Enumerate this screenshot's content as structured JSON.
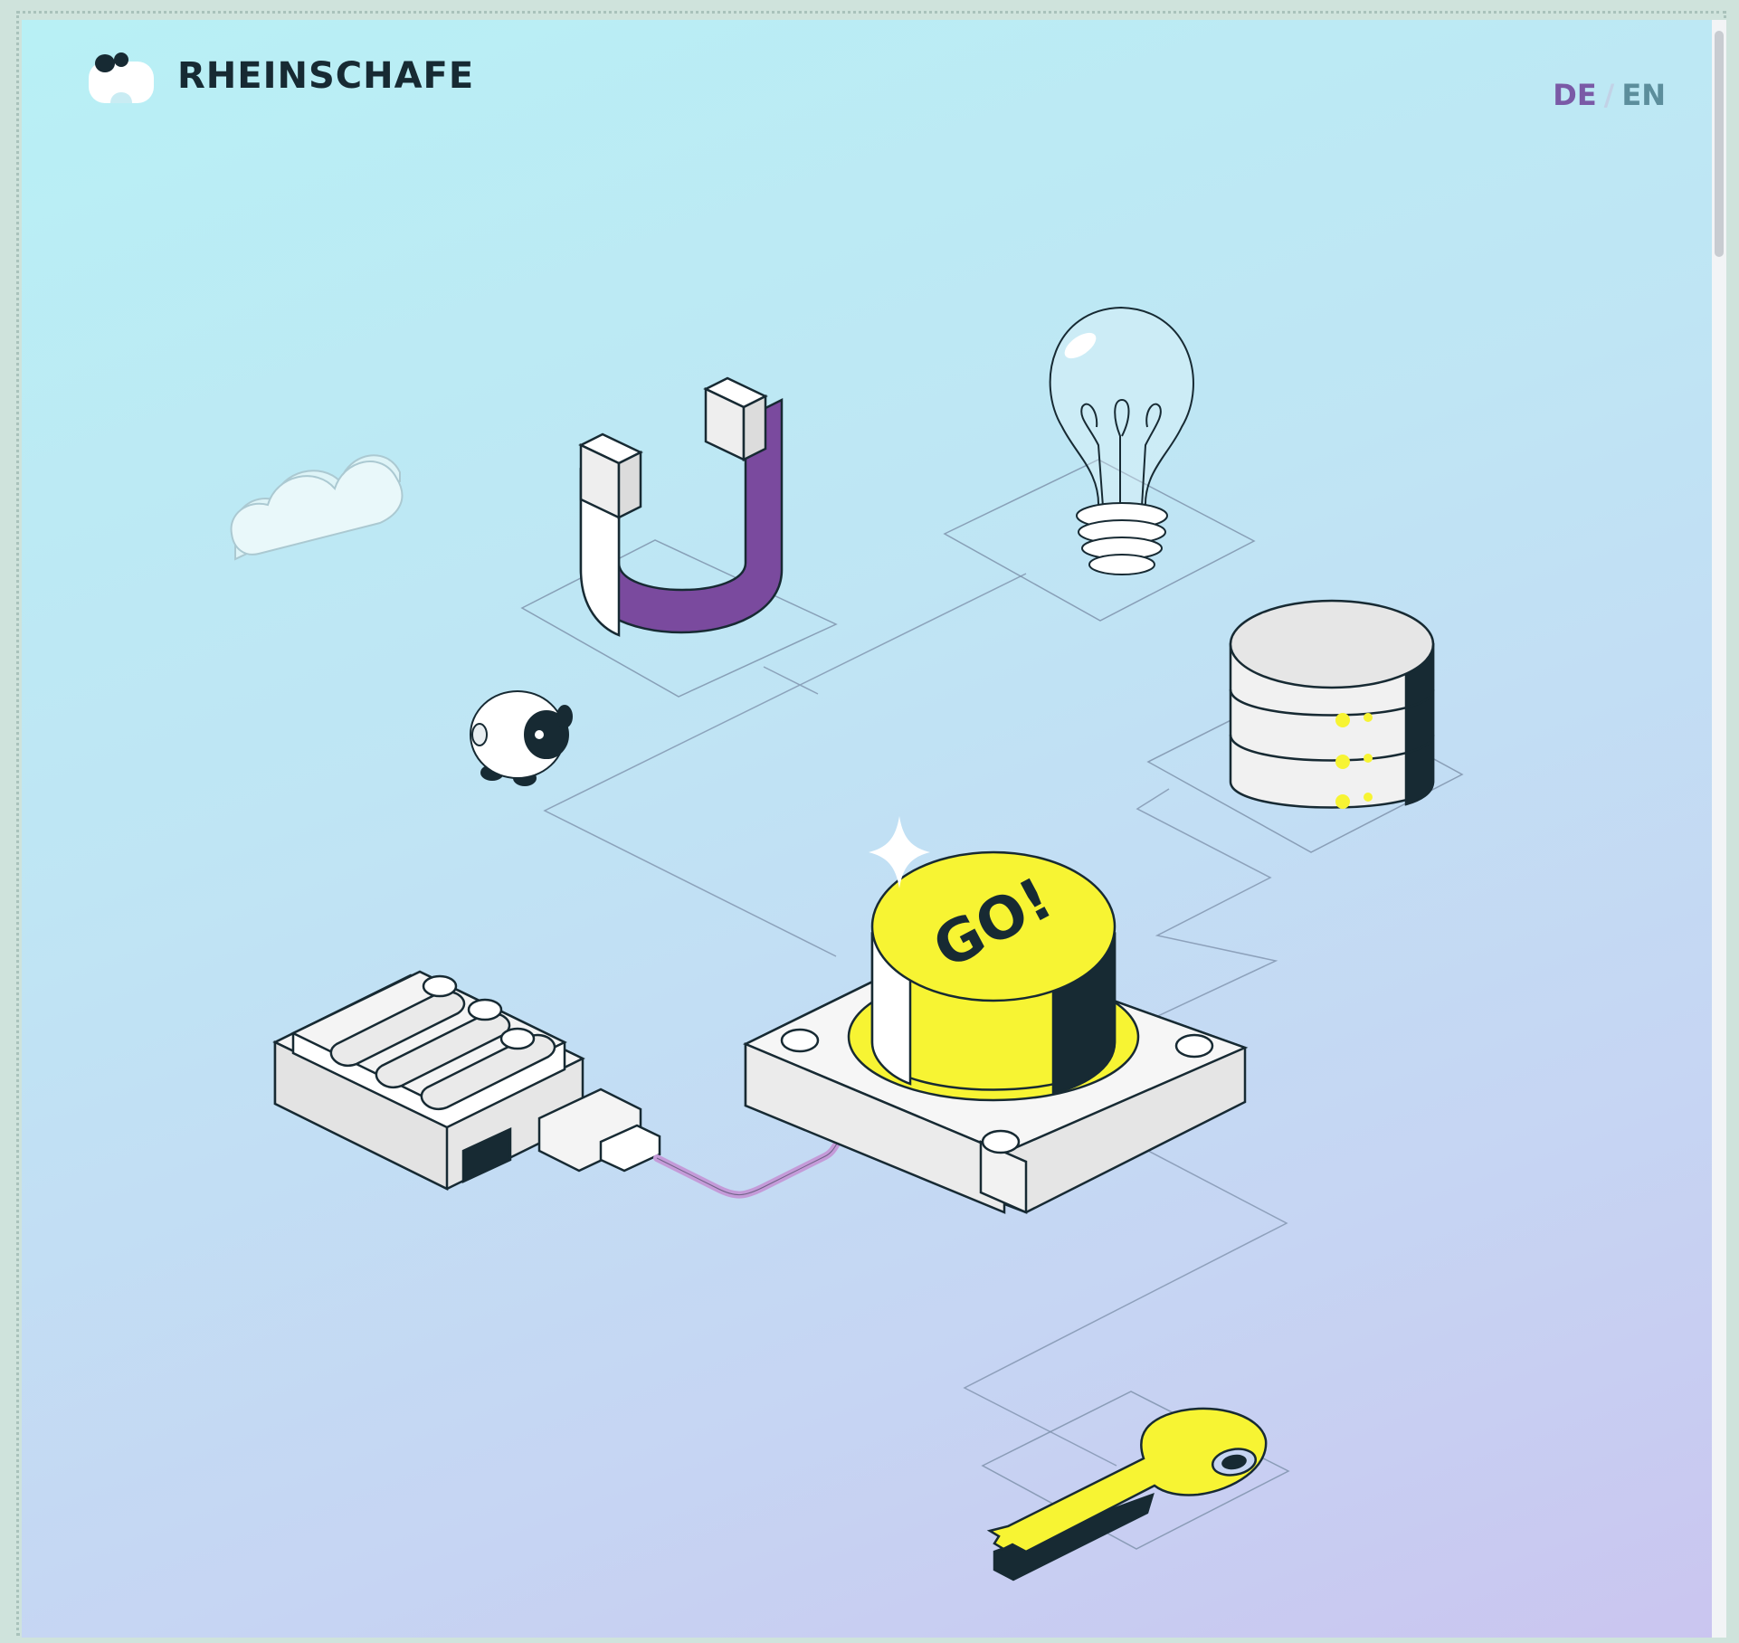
{
  "site": {
    "logo_text": "RHEINSCHAFE"
  },
  "language_switcher": {
    "de": "DE",
    "separator": "/",
    "en": "EN",
    "active": "DE"
  },
  "hero": {
    "button_label": "GO!"
  },
  "colors": {
    "accent_yellow": "#f7f433",
    "accent_purple": "#7a4a9e",
    "dark": "#172a33",
    "line": "#7b8ea8"
  },
  "icons": [
    "cloud-icon",
    "magnet-icon",
    "lightbulb-icon",
    "database-icon",
    "sheep-icon",
    "mixer-icon",
    "go-button-icon",
    "key-icon",
    "sparkle-icon"
  ]
}
